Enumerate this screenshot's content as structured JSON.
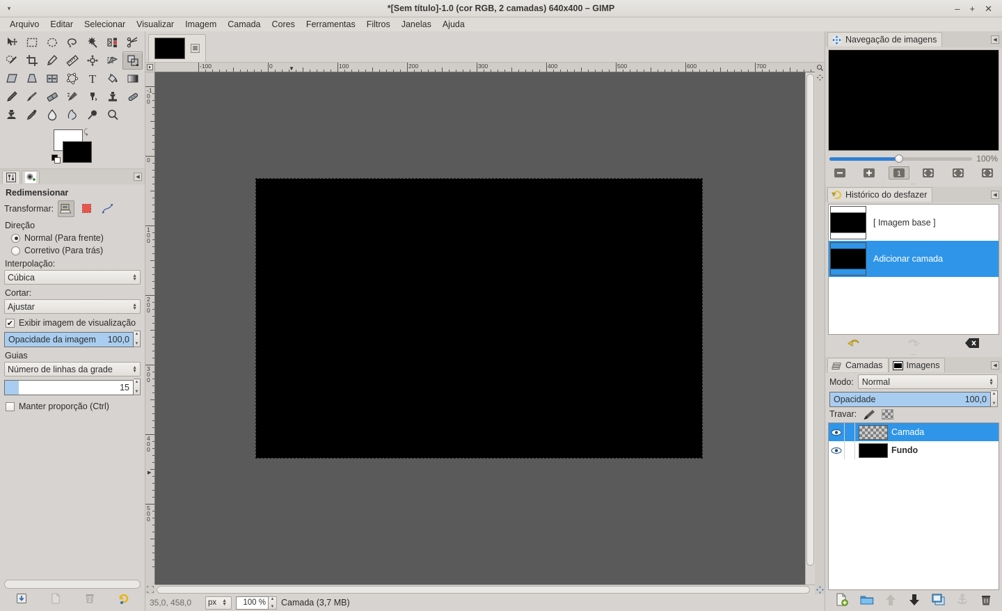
{
  "window": {
    "title": "*[Sem título]-1.0 (cor RGB, 2 camadas) 640x400 – GIMP",
    "minimize": "–",
    "maximize": "+",
    "close": "✕",
    "menu_arrow": "▾"
  },
  "menubar": {
    "items": [
      {
        "label": "Arquivo"
      },
      {
        "label": "Editar"
      },
      {
        "label": "Selecionar"
      },
      {
        "label": "Visualizar"
      },
      {
        "label": "Imagem"
      },
      {
        "label": "Camada"
      },
      {
        "label": "Cores"
      },
      {
        "label": "Ferramentas"
      },
      {
        "label": "Filtros"
      },
      {
        "label": "Janelas"
      },
      {
        "label": "Ajuda"
      }
    ]
  },
  "toolbox": {
    "tools": [
      {
        "name": "move-tool",
        "title": "Mover"
      },
      {
        "name": "rectangle-select-tool",
        "title": "Seleção retangular"
      },
      {
        "name": "ellipse-select-tool",
        "title": "Seleção elíptica"
      },
      {
        "name": "free-select-tool",
        "title": "Seleção livre"
      },
      {
        "name": "fuzzy-select-tool",
        "title": "Seleção contígua"
      },
      {
        "name": "select-by-color-tool",
        "title": "Selecionar por cor"
      },
      {
        "name": "scissors-select-tool",
        "title": "Tesoura inteligente"
      },
      {
        "name": "foreground-select-tool",
        "title": "Seleção de frente"
      },
      {
        "name": "crop-tool",
        "title": "Cortar"
      },
      {
        "name": "paths-tool",
        "title": "Caminhos"
      },
      {
        "name": "measure-tool",
        "title": "Medida"
      },
      {
        "name": "align-tool",
        "title": "Alinhamento"
      },
      {
        "name": "transform-tool",
        "title": "Transformação"
      },
      {
        "name": "scale-tool",
        "title": "Redimensionar"
      },
      {
        "name": "shear-tool",
        "title": "Inclinar"
      },
      {
        "name": "perspective-tool",
        "title": "Perspectiva"
      },
      {
        "name": "flip-tool",
        "title": "Espelhar"
      },
      {
        "name": "cage-transform-tool",
        "title": "Transformação por gaiola"
      },
      {
        "name": "text-tool",
        "title": "Texto"
      },
      {
        "name": "bucket-fill-tool",
        "title": "Preenchimento"
      },
      {
        "name": "gradient-tool",
        "title": "Degradê"
      },
      {
        "name": "pencil-tool",
        "title": "Lápis"
      },
      {
        "name": "paintbrush-tool",
        "title": "Pincel"
      },
      {
        "name": "eraser-tool",
        "title": "Borracha"
      },
      {
        "name": "airbrush-tool",
        "title": "Aerógrafo"
      },
      {
        "name": "ink-tool",
        "title": "Tinta"
      },
      {
        "name": "clone-tool",
        "title": "Clonar"
      },
      {
        "name": "heal-tool",
        "title": "Restaurar"
      },
      {
        "name": "perspective-clone-tool",
        "title": "Clonar em perspectiva"
      },
      {
        "name": "color-picker-tool",
        "title": "Seletor de cores"
      },
      {
        "name": "blur-tool",
        "title": "Desfocar"
      },
      {
        "name": "smudge-tool",
        "title": "Borrar"
      },
      {
        "name": "dodge-burn-tool",
        "title": "Sub-exposição"
      },
      {
        "name": "zoom-tool",
        "title": "Zoom"
      }
    ],
    "active_tool_index": 13,
    "foreground_color": "#ffffff",
    "background_color": "#000000"
  },
  "tool_options": {
    "tab_options_label": "Opções de ferramentas",
    "tab_brushes_label": "Pincéis",
    "title": "Redimensionar",
    "transform_label": "Transformar:",
    "transform_buttons": [
      {
        "name": "transform-layer-button",
        "active": true
      },
      {
        "name": "transform-selection-button",
        "active": false
      },
      {
        "name": "transform-path-button",
        "active": false
      }
    ],
    "direction_label": "Direção",
    "direction_options": [
      {
        "label": "Normal (Para frente)",
        "selected": true
      },
      {
        "label": "Corretivo (Para trás)",
        "selected": false
      }
    ],
    "interpolation_label": "Interpolação:",
    "interpolation_value": "Cúbica",
    "clip_label": "Cortar:",
    "clip_value": "Ajustar",
    "preview_label": "Exibir imagem de visualização",
    "preview_checked": true,
    "opacity_label": "Opacidade da imagem",
    "opacity_value": "100,0",
    "guides_label": "Guias",
    "guides_value": "Número de linhas da grade",
    "guides_count": "15",
    "keep_aspect_label": "Manter proporção (Ctrl)",
    "keep_aspect_checked": false,
    "footer_buttons": [
      {
        "name": "save-tool-options-button"
      },
      {
        "name": "restore-tool-options-button"
      },
      {
        "name": "delete-tool-options-button"
      },
      {
        "name": "reset-tool-options-button"
      }
    ]
  },
  "image_tab": {
    "close_glyph": "⊠"
  },
  "rulers": {
    "horizontal_labels": [
      "-100",
      "0",
      "100",
      "200",
      "300",
      "400",
      "500",
      "600",
      "700"
    ],
    "vertical_labels": [
      "-100",
      "0",
      "100",
      "200",
      "300",
      "400",
      "500"
    ],
    "unit": "px"
  },
  "statusbar": {
    "position": "35,0, 458,0",
    "unit": "px",
    "zoom": "100 %",
    "message": "Camada (3,7 MB)"
  },
  "navigation": {
    "tab_label": "Navegação de imagens",
    "zoom_percent": "100%",
    "buttons": [
      {
        "name": "zoom-out-button",
        "glyph": "–"
      },
      {
        "name": "zoom-in-button",
        "glyph": "+"
      },
      {
        "name": "zoom-1-1-button",
        "glyph": "1"
      },
      {
        "name": "fit-image-in-window-button",
        "glyph": "⛶"
      },
      {
        "name": "fill-window-button",
        "glyph": "⛶"
      },
      {
        "name": "zoom-image-window-button",
        "glyph": "⛶"
      }
    ]
  },
  "undo_history": {
    "tab_label": "Histórico do desfazer",
    "items": [
      {
        "label": "[ Imagem base ]",
        "selected": false
      },
      {
        "label": "Adicionar camada",
        "selected": true
      }
    ],
    "buttons": [
      {
        "name": "undo-button"
      },
      {
        "name": "redo-button"
      },
      {
        "name": "clear-undo-history-button"
      }
    ]
  },
  "layers": {
    "tab_layers_label": "Camadas",
    "tab_images_label": "Imagens",
    "mode_label": "Modo:",
    "mode_value": "Normal",
    "opacity_label": "Opacidade",
    "opacity_value": "100,0",
    "lock_label": "Travar:",
    "lock_buttons": [
      {
        "name": "lock-pixels-button"
      },
      {
        "name": "lock-alpha-button"
      }
    ],
    "rows": [
      {
        "name": "Camada",
        "selected": true,
        "visible": true,
        "thumb": "checker"
      },
      {
        "name": "Fundo",
        "selected": false,
        "visible": true,
        "thumb": "#000000"
      }
    ],
    "buttons": [
      {
        "name": "new-layer-button"
      },
      {
        "name": "new-layer-group-button"
      },
      {
        "name": "raise-layer-button"
      },
      {
        "name": "lower-layer-button"
      },
      {
        "name": "duplicate-layer-button"
      },
      {
        "name": "anchor-layer-button"
      },
      {
        "name": "delete-layer-button"
      }
    ]
  },
  "canvas": {
    "background_color": "#5a5a5a",
    "layer_color": "#000000",
    "selection_dash_color": "#e8e83c"
  }
}
